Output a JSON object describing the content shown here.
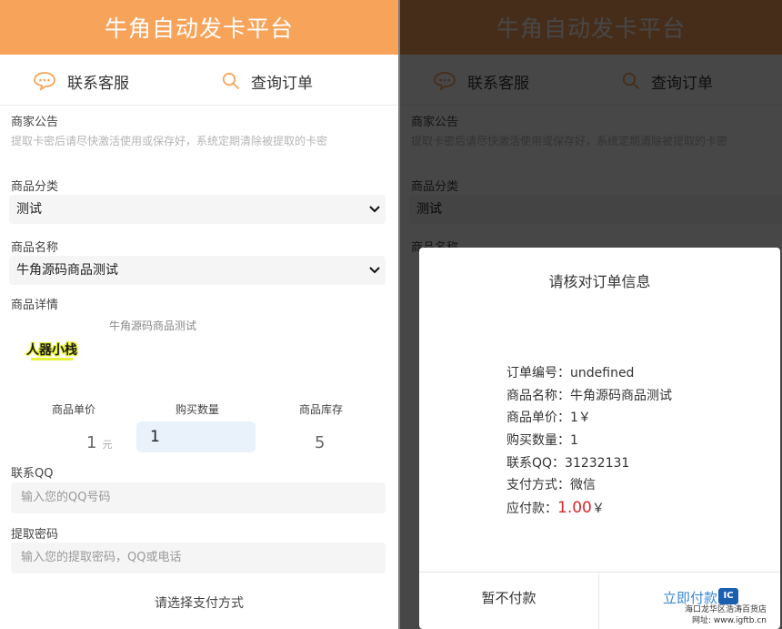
{
  "header": {
    "title": "牛角自动发卡平台"
  },
  "nav": {
    "contact": "联系客服",
    "query": "查询订单"
  },
  "notice": {
    "label": "商家公告",
    "text": "提取卡密后请尽快激活使用或保存好，系统定期清除被提取的卡密"
  },
  "category": {
    "label": "商品分类",
    "selected": "测试"
  },
  "product": {
    "label": "商品名称",
    "selected": "牛角源码商品测试"
  },
  "detail": {
    "label": "商品详情",
    "text": "牛角源码商品测试",
    "logo_text": "人器小栈"
  },
  "purchase": {
    "price_label": "商品单价",
    "price": "1",
    "unit": "元",
    "qty_label": "购买数量",
    "qty": "1",
    "stock_label": "商品库存",
    "stock": "5"
  },
  "contact_qq": {
    "label": "联系QQ",
    "placeholder": "输入您的QQ号码"
  },
  "pickup": {
    "label": "提取密码",
    "placeholder": "输入您的提取密码，QQ或电话"
  },
  "payment": {
    "title": "请选择支付方式"
  },
  "modal": {
    "title": "请核对订单信息",
    "rows": [
      {
        "label": "订单编号：",
        "value": "undefined"
      },
      {
        "label": "商品名称：",
        "value": "牛角源码商品测试"
      },
      {
        "label": "商品单价：",
        "value": "1￥"
      },
      {
        "label": "购买数量：",
        "value": "1"
      },
      {
        "label": "联系QQ：",
        "value": "31232131"
      },
      {
        "label": "支付方式：",
        "value": "微信"
      }
    ],
    "amount_label": "应付款：",
    "amount": "1.00",
    "currency": "￥",
    "cancel": "暂不付款",
    "confirm": "立即付款"
  },
  "watermark": {
    "badge": "IC",
    "line1": "海口龙华区浩涛百货店",
    "line2": "网址: www.igftb.cn"
  },
  "colors": {
    "brand": "#f8a35a",
    "amount": "#d9262b",
    "confirm": "#3a89d6"
  }
}
